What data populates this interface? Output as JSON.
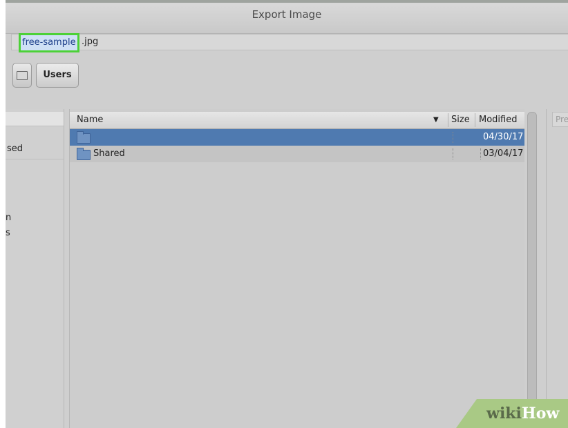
{
  "window": {
    "title": "Export Image"
  },
  "filename": {
    "selected_part": "free-sample",
    "extension": ".jpg"
  },
  "pathbar": {
    "folder_label": "Users"
  },
  "sidebar": {
    "items": [
      "sed",
      "n",
      "s"
    ]
  },
  "file_list": {
    "columns": {
      "name": "Name",
      "sort": "▼",
      "size": "Size",
      "modified": "Modified"
    },
    "rows": [
      {
        "name": "",
        "size": "",
        "modified": "04/30/17",
        "selected": true
      },
      {
        "name": "Shared",
        "size": "",
        "modified": "03/04/17",
        "selected": false
      }
    ]
  },
  "preview": {
    "label": "Pre"
  },
  "watermark": {
    "text_a": "wiki",
    "text_b": "How"
  },
  "colors": {
    "selection": "#4f7ab0",
    "highlight_border": "#4cd137"
  }
}
